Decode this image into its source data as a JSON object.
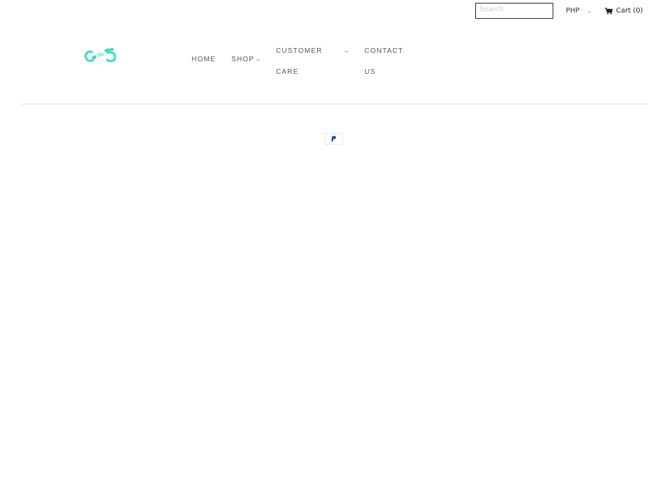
{
  "header": {
    "search": {
      "placeholder": "Search",
      "value": ""
    },
    "currency": {
      "selected": "PHP"
    },
    "cart": {
      "label": "Cart (0)",
      "count": 0
    }
  },
  "logo": {
    "alt": "handcuffs logo",
    "color": "#3fdcc4"
  },
  "nav": {
    "items": [
      {
        "label": "HOME",
        "has_dropdown": false
      },
      {
        "label": "SHOP",
        "has_dropdown": true
      },
      {
        "label_line1": "CUSTOMER",
        "label_line2": "CARE",
        "has_dropdown": true
      },
      {
        "label_line1": "CONTACT",
        "label_line2": "US",
        "has_dropdown": false
      }
    ]
  },
  "footer": {
    "payment_icons": [
      {
        "name": "PayPal",
        "color": "#253b80"
      }
    ]
  }
}
